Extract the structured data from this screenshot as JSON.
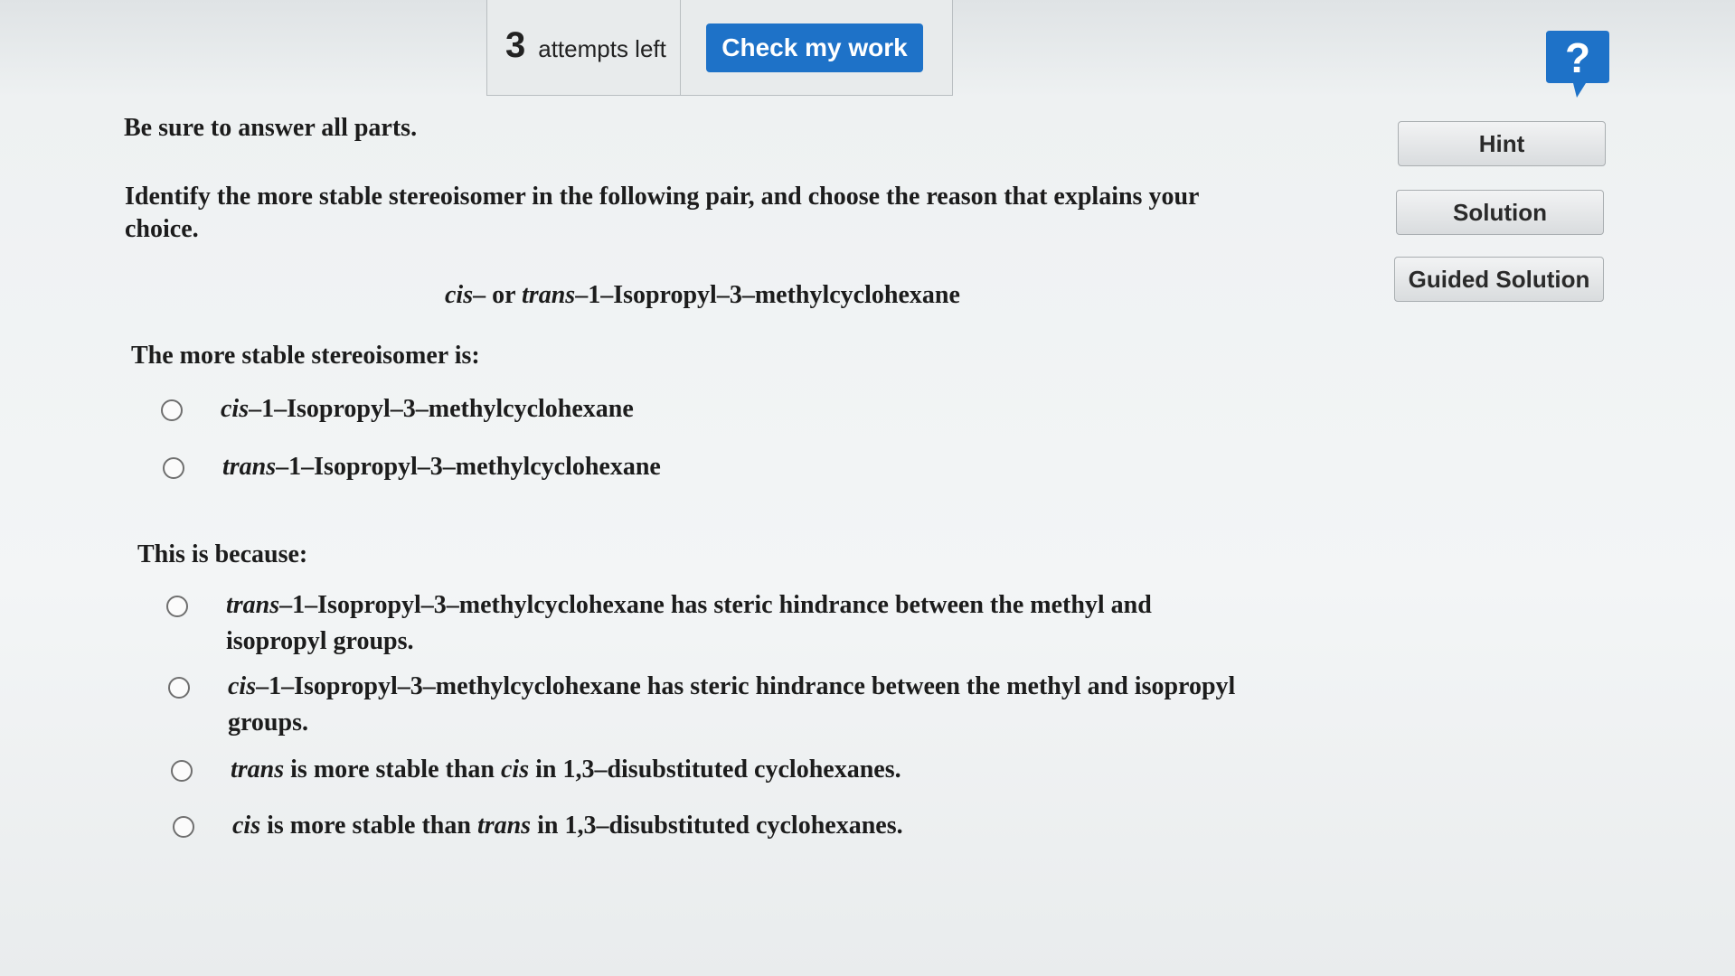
{
  "top_bar": {
    "attempts_count": "3",
    "attempts_label": "attempts left",
    "check_button_label": "Check my work"
  },
  "help": {
    "icon": "question-speech-bubble-icon",
    "symbol": "?",
    "color": "#1e72c8"
  },
  "side_buttons": {
    "hint_label": "Hint",
    "solution_label": "Solution",
    "guided_solution_label": "Guided Solution"
  },
  "instructions": "Be sure to answer all parts.",
  "question": "Identify the more stable stereoisomer in the following pair, and choose the reason that explains your choice.",
  "compound": {
    "cis": "cis",
    "dash1": "– or ",
    "trans": "trans",
    "rest": "–1–Isopropyl–3–methylcyclohexane"
  },
  "part1": {
    "label": "The more stable stereoisomer is:",
    "options": [
      {
        "prefix": "cis",
        "rest": "–1–Isopropyl–3–methylcyclohexane"
      },
      {
        "prefix": "trans",
        "rest": "–1–Isopropyl–3–methylcyclohexane"
      }
    ]
  },
  "part2": {
    "label": "This is because:",
    "options": [
      {
        "prefix": "trans",
        "rest": "–1–Isopropyl–3–methylcyclohexane has steric hindrance between the methyl and isopropyl groups."
      },
      {
        "prefix": "cis",
        "rest": "–1–Isopropyl–3–methylcyclohexane has steric hindrance between the methyl and isopropyl groups."
      },
      {
        "a": "trans",
        "b": " is more stable than ",
        "c": "cis",
        "d": " in 1,3–disubstituted cyclohexanes."
      },
      {
        "a": "cis",
        "b": " is more stable than ",
        "c": "trans",
        "d": " in 1,3–disubstituted cyclohexanes."
      }
    ]
  },
  "colors": {
    "accent": "#1e72c8",
    "background": "#eef1f2",
    "text": "#1c1c1c"
  }
}
